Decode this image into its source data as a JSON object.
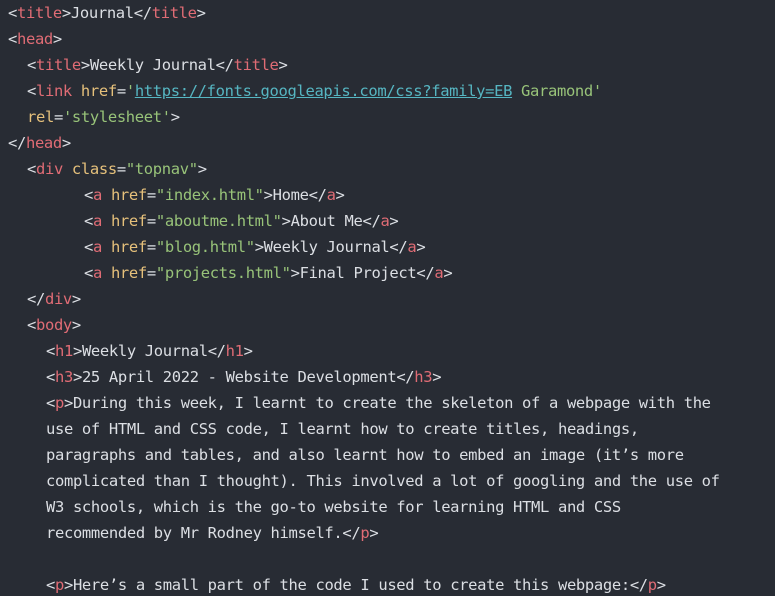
{
  "code": {
    "l1_tag": "title",
    "l1_text": "Journal",
    "l2_tag": "head",
    "l3_tag": "title",
    "l3_text": "Weekly Journal",
    "l4_tag": "link",
    "l4_attr": "href",
    "l4_q": "'",
    "l4_url": "https://fonts.googleapis.com/css?family=EB",
    "l4_rest": " Garamond'",
    "l5_attr": "rel",
    "l5_val": "'stylesheet'",
    "l6_tag": "head",
    "l7_tag": "div",
    "l7_attr": "class",
    "l7_val": "\"topnav\"",
    "nav_links": [
      {
        "href": "\"index.html\"",
        "label": "Home"
      },
      {
        "href": "\"aboutme.html\"",
        "label": "About Me"
      },
      {
        "href": "\"blog.html\"",
        "label": "Weekly Journal"
      },
      {
        "href": "\"projects.html\"",
        "label": "Final Project"
      }
    ],
    "a_tag": "a",
    "a_attr": "href",
    "l12_tag": "div",
    "l13_tag": "body",
    "h1_tag": "h1",
    "h1_text": "Weekly Journal",
    "h3_tag": "h3",
    "h3_text": "25 April 2022 - Website Development",
    "p_tag": "p",
    "para1": [
      "During this week, I learnt to create the skeleton of a webpage with the",
      "use of HTML and CSS code, I learnt how to create titles, headings,",
      "paragraphs and tables, and also learnt how to embed an image (it’s more",
      "complicated than I thought). This involved a lot of googling and the use of",
      "W3 schools, which is the go-to website for learning HTML and CSS",
      "recommended by Mr Rodney himself."
    ],
    "para2_text": "Here’s a small part of the code I used to create this webpage:"
  },
  "colors": {
    "background": "#282c34",
    "tag": "#e06c75",
    "attribute": "#e5c07b",
    "string": "#98c379",
    "url": "#56b6c2",
    "text": "#dcdfe4"
  }
}
